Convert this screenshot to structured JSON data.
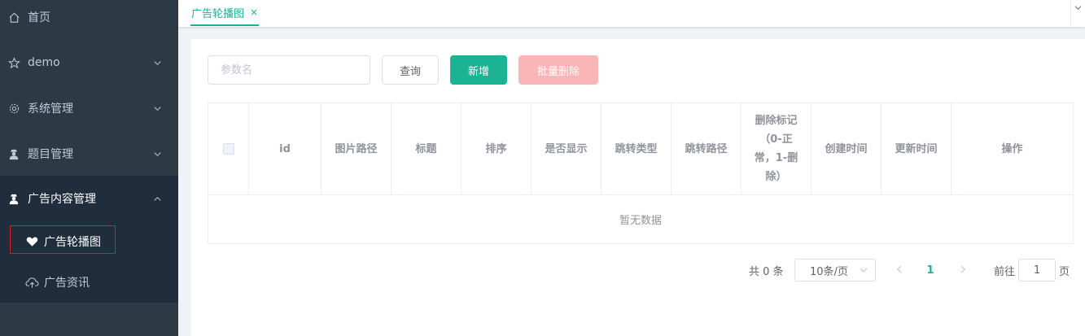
{
  "colors": {
    "accent": "#1ab394",
    "sidebar_bg": "#2b3a44",
    "danger_light": "#fab6b6",
    "highlight_border": "#e0191f"
  },
  "sidebar": {
    "items": [
      {
        "label": "首页",
        "icon": "home-icon"
      },
      {
        "label": "demo",
        "icon": "star-icon"
      },
      {
        "label": "系统管理",
        "icon": "gear-icon"
      },
      {
        "label": "题目管理",
        "icon": "user-spy-icon"
      },
      {
        "label": "广告内容管理",
        "icon": "user-spy-icon",
        "expanded": true
      }
    ],
    "subitems": [
      {
        "label": "广告轮播图",
        "icon": "heart-icon",
        "active": true
      },
      {
        "label": "广告资讯",
        "icon": "cloud-upload-icon"
      }
    ]
  },
  "tabs": [
    {
      "label": "广告轮播图",
      "close": "×"
    }
  ],
  "toolbar": {
    "search_placeholder": "参数名",
    "query_label": "查询",
    "add_label": "新增",
    "batch_delete_label": "批量删除"
  },
  "table": {
    "columns": [
      "id",
      "图片路径",
      "标题",
      "排序",
      "是否显示",
      "跳转类型",
      "跳转路径",
      "删除标记（0-正常，1-删除）",
      "创建时间",
      "更新时间",
      "操作"
    ],
    "empty_text": "暂无数据"
  },
  "pagination": {
    "total_text": "共 0 条",
    "page_size": "10条/页",
    "current_page": "1",
    "goto_label": "前往",
    "goto_value": "1",
    "goto_suffix": "页"
  }
}
